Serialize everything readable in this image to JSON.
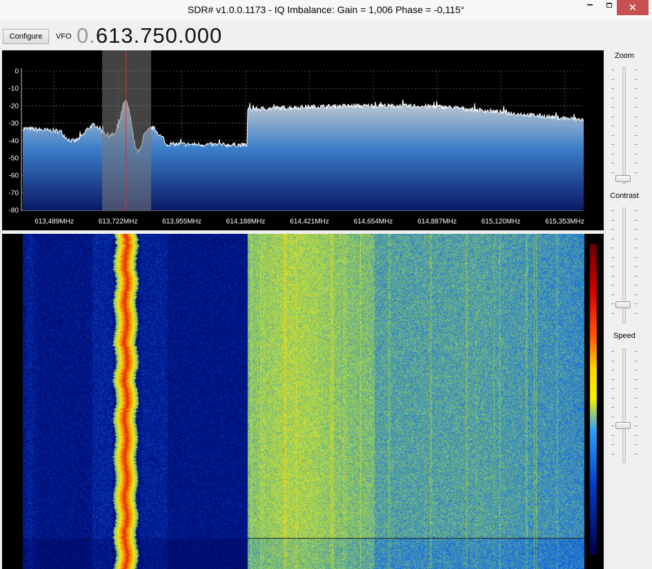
{
  "window": {
    "title": "SDR# v1.0.0.1173 - IQ Imbalance: Gain = 1,006 Phase = -0,115°",
    "minimize_icon": "minimize-icon",
    "maximize_icon": "maximize-icon",
    "close_glyph": "✕"
  },
  "toolbar": {
    "configure_label": "Configure",
    "vfo_label": "VFO",
    "vfo_freq_prefix": "0.",
    "vfo_freq_main": "613.750.000"
  },
  "spectrum": {
    "y_ticks": [
      "0",
      "-10",
      "-20",
      "-30",
      "-40",
      "-50",
      "-60",
      "-70",
      "-80"
    ],
    "x_ticks": [
      "613,489MHz",
      "613,722MHz",
      "613,955MHz",
      "614,188MHz",
      "614,421MHz",
      "614,654MHz",
      "614,887MHz",
      "615,120MHz",
      "615,353MHz"
    ],
    "colors": {
      "background": "#000000",
      "trace": "#ffffff",
      "fill_top": "#c8cdd2",
      "fill_bottom": "#0a1a66",
      "cursor": "#ff2020",
      "filter_band": "#7a7a7a"
    }
  },
  "sidebar": {
    "zoom_label": "Zoom",
    "contrast_label": "Contrast",
    "speed_label": "Speed"
  }
}
